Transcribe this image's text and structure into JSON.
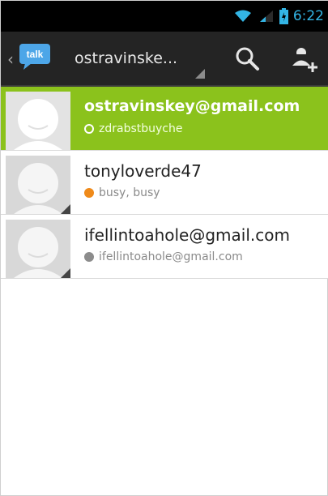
{
  "status_bar": {
    "time": "6:22",
    "wifi_icon": "wifi-icon",
    "signal_icon": "signal-icon",
    "battery_icon": "battery-icon"
  },
  "action_bar": {
    "logo_text": "talk",
    "account": "ostravinske...",
    "search_icon": "search-icon",
    "add_friend_icon": "add-friend-icon"
  },
  "friends": [
    {
      "name": "ostravinskey@gmail.com",
      "status": "zdrabstbuyche",
      "presence": "available",
      "selected": true
    },
    {
      "name": "tonyloverde47",
      "status": "busy, busy",
      "presence": "busy",
      "selected": false
    },
    {
      "name": "ifellintoahole@gmail.com",
      "status": "ifellintoahole@gmail.com",
      "presence": "offline",
      "selected": false
    }
  ],
  "colors": {
    "accent": "#8bc21c",
    "busy": "#ef8a1a",
    "clock": "#33b5e5"
  }
}
